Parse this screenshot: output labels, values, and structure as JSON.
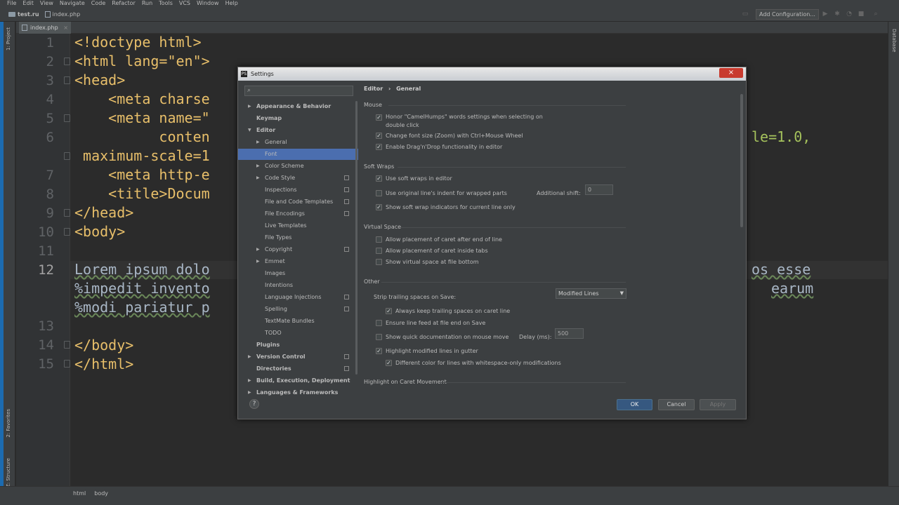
{
  "menu": [
    "File",
    "Edit",
    "View",
    "Navigate",
    "Code",
    "Refactor",
    "Run",
    "Tools",
    "VCS",
    "Window",
    "Help"
  ],
  "nav": {
    "project": "test.ru",
    "file": "index.php",
    "add_config": "Add Configuration..."
  },
  "left_tools": {
    "project": "1: Project",
    "favorites": "2: Favorites",
    "structure": "Z: Structure"
  },
  "right_tools": {
    "database": "Database"
  },
  "tab": {
    "label": "index.php"
  },
  "editor": {
    "line_numbers": [
      "1",
      "2",
      "3",
      "4",
      "5",
      "6",
      "",
      "7",
      "8",
      "9",
      "10",
      "11",
      "12",
      "",
      "",
      "13",
      "14",
      "15"
    ],
    "lines": [
      "<!doctype html>",
      "<html lang=\"en\">",
      "<head>",
      "    <meta charse",
      "    <meta name=\"",
      "          conten",
      " maximum-scale=1",
      "    <meta http-e",
      "    <title>Docum",
      "</head>",
      "<body>",
      "",
      "Lorem ipsum dolo",
      "%impedit invento",
      "%modi pariatur p",
      "",
      "</body>",
      "</html>"
    ],
    "right_fragments": {
      "line6": "le=1.0,",
      "line12": "os esse",
      "line12b": "earum"
    }
  },
  "statusbar": {
    "crumbs": [
      "html",
      "body"
    ]
  },
  "dialog": {
    "title": "Settings",
    "breadcrumb_a": "Editor",
    "breadcrumb_sep": "›",
    "breadcrumb_b": "General",
    "tree": [
      {
        "label": "Appearance & Behavior",
        "arrow": "▶"
      },
      {
        "label": "Keymap",
        "arrow": ""
      },
      {
        "label": "Editor",
        "arrow": "▼"
      },
      {
        "label": "General",
        "arrow": "▶"
      },
      {
        "label": "Font",
        "arrow": ""
      },
      {
        "label": "Color Scheme",
        "arrow": "▶"
      },
      {
        "label": "Code Style",
        "arrow": "▶"
      },
      {
        "label": "Inspections",
        "arrow": ""
      },
      {
        "label": "File and Code Templates",
        "arrow": ""
      },
      {
        "label": "File Encodings",
        "arrow": ""
      },
      {
        "label": "Live Templates",
        "arrow": ""
      },
      {
        "label": "File Types",
        "arrow": ""
      },
      {
        "label": "Copyright",
        "arrow": "▶"
      },
      {
        "label": "Emmet",
        "arrow": "▶"
      },
      {
        "label": "Images",
        "arrow": ""
      },
      {
        "label": "Intentions",
        "arrow": ""
      },
      {
        "label": "Language Injections",
        "arrow": ""
      },
      {
        "label": "Spelling",
        "arrow": ""
      },
      {
        "label": "TextMate Bundles",
        "arrow": ""
      },
      {
        "label": "TODO",
        "arrow": ""
      },
      {
        "label": "Plugins",
        "arrow": ""
      },
      {
        "label": "Version Control",
        "arrow": "▶"
      },
      {
        "label": "Directories",
        "arrow": ""
      },
      {
        "label": "Build, Execution, Deployment",
        "arrow": "▶"
      },
      {
        "label": "Languages & Frameworks",
        "arrow": "▶"
      }
    ],
    "sections": {
      "mouse": "Mouse",
      "soft_wraps": "Soft Wraps",
      "virtual_space": "Virtual Space",
      "other": "Other",
      "caret": "Highlight on Caret Movement"
    },
    "options": {
      "camel_a": "Honor \"CamelHumps\" words settings when selecting on",
      "camel_b": "double click",
      "zoom": "Change font size (Zoom) with Ctrl+Mouse Wheel",
      "dnd": "Enable Drag'n'Drop functionality in editor",
      "soft_wraps": "Use soft wraps in editor",
      "orig_indent": "Use original line's indent for wrapped parts",
      "add_shift_label": "Additional shift:",
      "add_shift_value": "0",
      "wrap_ind": "Show soft wrap indicators for current line only",
      "caret_end": "Allow placement of caret after end of line",
      "caret_tabs": "Allow placement of caret inside tabs",
      "virt_bottom": "Show virtual space at file bottom",
      "strip_label": "Strip trailing spaces on Save:",
      "strip_value": "Modified Lines",
      "keep_trailing": "Always keep trailing spaces on caret line",
      "line_feed": "Ensure line feed at file end on Save",
      "quick_doc": "Show quick documentation on mouse move",
      "delay_label": "Delay (ms):",
      "delay_value": "500",
      "highlight_mod": "Highlight modified lines in gutter",
      "diff_color": "Different color for lines with whitespace-only modifications"
    },
    "buttons": {
      "ok": "OK",
      "cancel": "Cancel",
      "apply": "Apply",
      "help": "?"
    }
  }
}
